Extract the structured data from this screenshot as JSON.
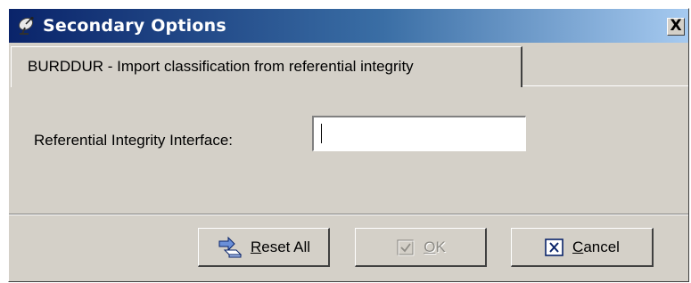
{
  "window": {
    "title": "Secondary Options",
    "close_label": "X"
  },
  "tab": {
    "label": "BURDDUR - Import classification from referential integrity"
  },
  "form": {
    "field_label": "Referential Integrity Interface:",
    "field_value": ""
  },
  "buttons": {
    "reset": {
      "mnemonic": "R",
      "rest": "eset All"
    },
    "ok": {
      "mnemonic": "O",
      "rest": "K",
      "enabled": false
    },
    "cancel": {
      "mnemonic": "C",
      "rest": "ancel"
    }
  },
  "icons": {
    "title": "satellite-dish-icon",
    "reset": "reset-eraser-icon",
    "ok": "checkmark-icon",
    "cancel": "x-box-icon"
  },
  "colors": {
    "title_gradient_start": "#0a246a",
    "title_gradient_end": "#a6caf0",
    "face": "#d4d0c8",
    "cancel_icon": "#0a246a"
  }
}
